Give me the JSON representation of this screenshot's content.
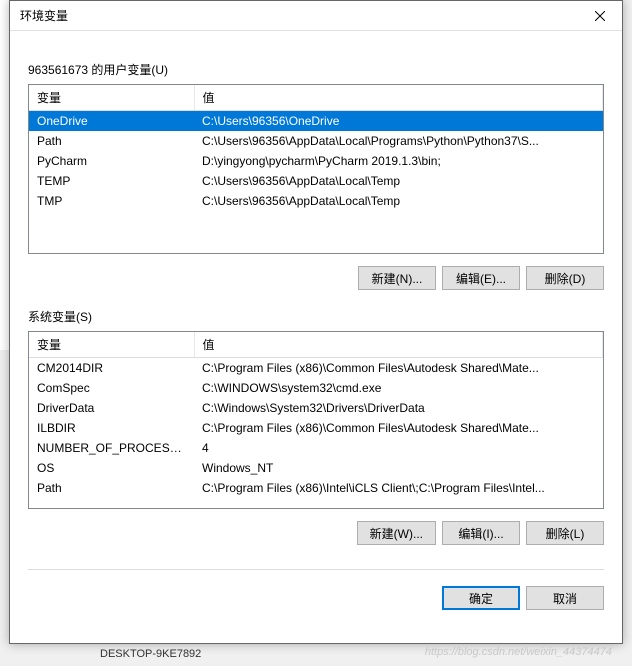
{
  "title": "环境变量",
  "userSection": {
    "label": "963561673 的用户变量(U)",
    "headers": {
      "var": "变量",
      "val": "值"
    },
    "rows": [
      {
        "var": "OneDrive",
        "val": "C:\\Users\\96356\\OneDrive",
        "selected": true
      },
      {
        "var": "Path",
        "val": "C:\\Users\\96356\\AppData\\Local\\Programs\\Python\\Python37\\S..."
      },
      {
        "var": "PyCharm",
        "val": "D:\\yingyong\\pycharm\\PyCharm 2019.1.3\\bin;"
      },
      {
        "var": "TEMP",
        "val": "C:\\Users\\96356\\AppData\\Local\\Temp"
      },
      {
        "var": "TMP",
        "val": "C:\\Users\\96356\\AppData\\Local\\Temp"
      }
    ],
    "buttons": {
      "new": "新建(N)...",
      "edit": "编辑(E)...",
      "delete": "删除(D)"
    }
  },
  "systemSection": {
    "label": "系统变量(S)",
    "headers": {
      "var": "变量",
      "val": "值"
    },
    "rows": [
      {
        "var": "CM2014DIR",
        "val": "C:\\Program Files (x86)\\Common Files\\Autodesk Shared\\Mate..."
      },
      {
        "var": "ComSpec",
        "val": "C:\\WINDOWS\\system32\\cmd.exe"
      },
      {
        "var": "DriverData",
        "val": "C:\\Windows\\System32\\Drivers\\DriverData"
      },
      {
        "var": "ILBDIR",
        "val": "C:\\Program Files (x86)\\Common Files\\Autodesk Shared\\Mate..."
      },
      {
        "var": "NUMBER_OF_PROCESSORS",
        "val": "4"
      },
      {
        "var": "OS",
        "val": "Windows_NT"
      },
      {
        "var": "Path",
        "val": "C:\\Program Files (x86)\\Intel\\iCLS Client\\;C:\\Program Files\\Intel..."
      }
    ],
    "buttons": {
      "new": "新建(W)...",
      "edit": "编辑(I)...",
      "delete": "删除(L)"
    }
  },
  "mainButtons": {
    "ok": "确定",
    "cancel": "取消"
  },
  "bg": {
    "desktop": "DESKTOP-9KE7892",
    "watermark": "https://blog.csdn.net/weixin_44374474"
  }
}
